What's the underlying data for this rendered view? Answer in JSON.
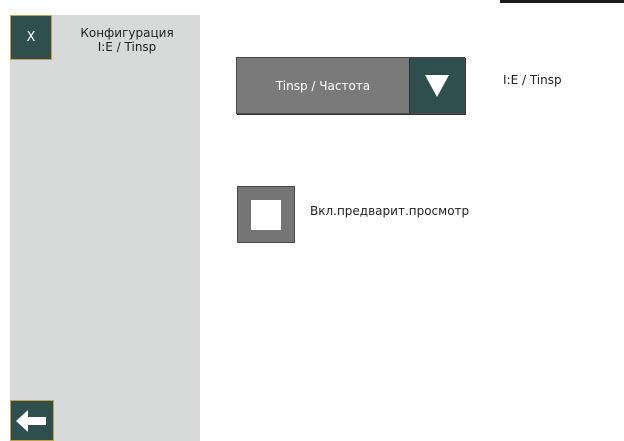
{
  "header": {
    "close_label": "X",
    "title_line1": "Конфигурация",
    "title_line2": "I:E / Tinsp"
  },
  "icons": {
    "close": "close-icon",
    "back": "arrow-left-icon",
    "dropdown": "triangle-down-icon"
  },
  "dropdown": {
    "selected": "Tinsp / Частота",
    "side_label": "I:E / Tinsp"
  },
  "preview": {
    "label": "Вкл.предварит.просмотр",
    "checked": false
  },
  "colors": {
    "accent": "#2e4f4d",
    "border_accent": "#c5a24a",
    "sidebar": "#d8d9d9",
    "control_gray": "#7a7a7a"
  }
}
